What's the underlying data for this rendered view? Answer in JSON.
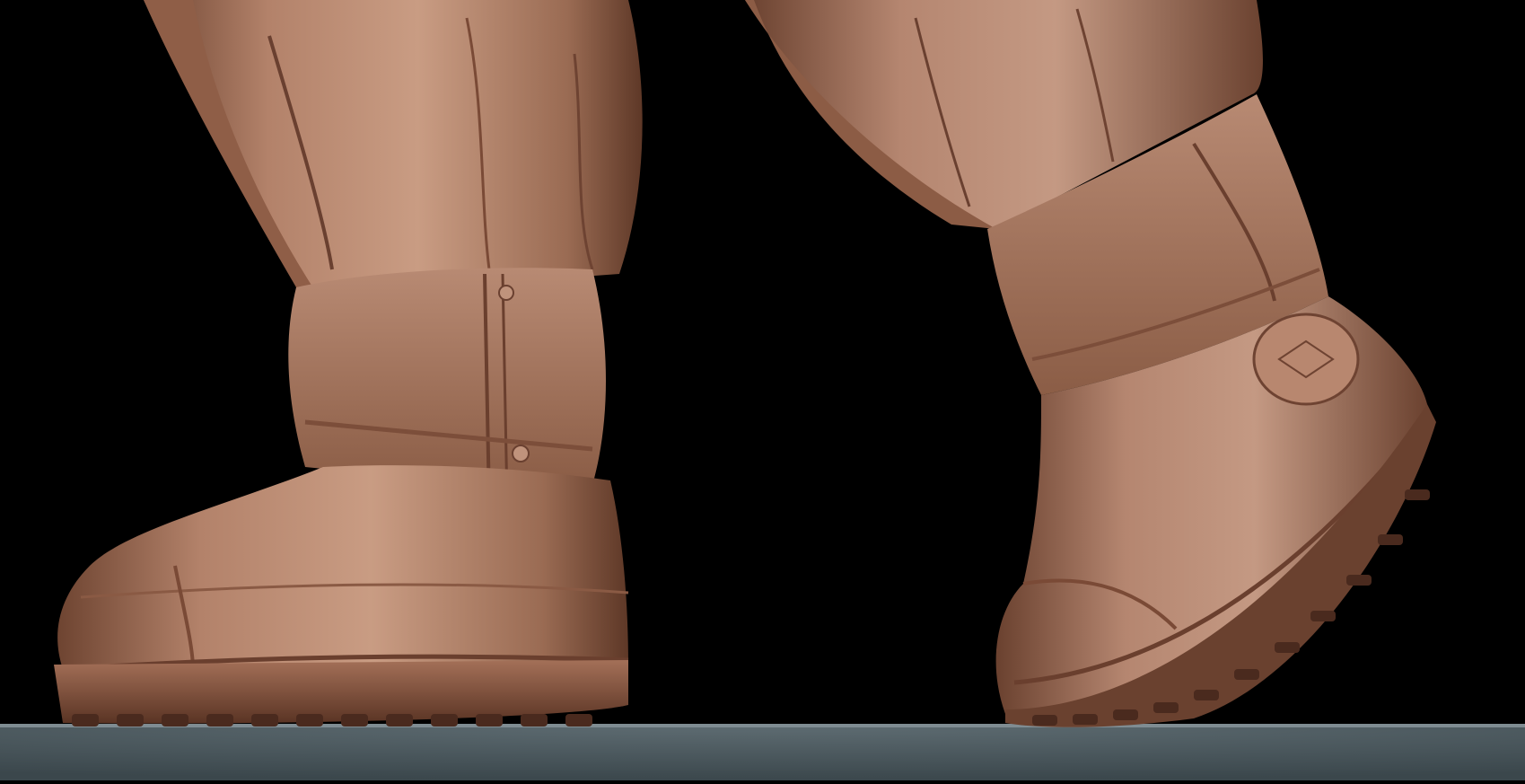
{
  "scene": {
    "description_free": true,
    "colors": {
      "background": "#000000",
      "clay_base": "#a8775d",
      "clay_light": "#d0a58c",
      "clay_shadow": "#5a3526",
      "floor": "#44525a"
    },
    "objects": [
      {
        "name": "left-boot",
        "type": "sculpted-boot"
      },
      {
        "name": "right-boot",
        "type": "sculpted-boot"
      },
      {
        "name": "ground-plane",
        "type": "floor"
      }
    ]
  }
}
